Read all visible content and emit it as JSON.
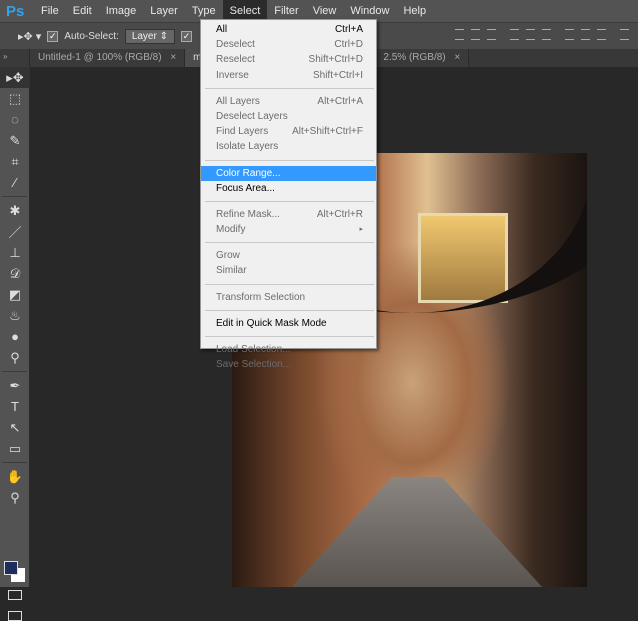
{
  "app": {
    "logo": "Ps"
  },
  "menubar": [
    "File",
    "Edit",
    "Image",
    "Layer",
    "Type",
    "Select",
    "Filter",
    "View",
    "Window",
    "Help"
  ],
  "options": {
    "auto_select_label": "Auto-Select:",
    "auto_select_checked": true,
    "target": "Layer",
    "check2": "✓"
  },
  "tabs": [
    {
      "label": "Untitled-1 @ 100% (RGB/8)",
      "close": "×"
    },
    {
      "label": "mar",
      "close": ""
    },
    {
      "label": "2.5% (RGB/8)",
      "close": "×"
    }
  ],
  "select_menu": [
    [
      {
        "label": "All",
        "shortcut": "Ctrl+A",
        "enabled": true
      },
      {
        "label": "Deselect",
        "shortcut": "Ctrl+D"
      },
      {
        "label": "Reselect",
        "shortcut": "Shift+Ctrl+D"
      },
      {
        "label": "Inverse",
        "shortcut": "Shift+Ctrl+I"
      }
    ],
    [
      {
        "label": "All Layers",
        "shortcut": "Alt+Ctrl+A"
      },
      {
        "label": "Deselect Layers",
        "shortcut": ""
      },
      {
        "label": "Find Layers",
        "shortcut": "Alt+Shift+Ctrl+F"
      },
      {
        "label": "Isolate Layers",
        "shortcut": ""
      }
    ],
    [
      {
        "label": "Color Range...",
        "shortcut": "",
        "highlighted": true
      },
      {
        "label": "Focus Area...",
        "shortcut": "",
        "enabled": true
      }
    ],
    [
      {
        "label": "Refine Mask...",
        "shortcut": "Alt+Ctrl+R"
      },
      {
        "label": "Modify",
        "shortcut": "▸"
      }
    ],
    [
      {
        "label": "Grow",
        "shortcut": ""
      },
      {
        "label": "Similar",
        "shortcut": ""
      }
    ],
    [
      {
        "label": "Transform Selection",
        "shortcut": ""
      }
    ],
    [
      {
        "label": "Edit in Quick Mask Mode",
        "shortcut": "",
        "enabled": true
      }
    ],
    [
      {
        "label": "Load Selection...",
        "shortcut": ""
      },
      {
        "label": "Save Selection...",
        "shortcut": ""
      }
    ]
  ],
  "tools": [
    [
      "move",
      "▸✥"
    ],
    [
      "marquee",
      "⬚"
    ],
    [
      "lasso",
      "◌"
    ],
    [
      "quick-select",
      "✎"
    ],
    [
      "crop",
      "⌗"
    ],
    [
      "eyedropper",
      "⁄"
    ],
    null,
    [
      "healing",
      "✱"
    ],
    [
      "brush",
      "／"
    ],
    [
      "stamp",
      "⊥"
    ],
    [
      "history-brush",
      "𝒟"
    ],
    [
      "eraser",
      "◩"
    ],
    [
      "paint-bucket",
      "♨"
    ],
    [
      "blur",
      "●"
    ],
    [
      "dodge",
      "⚲"
    ],
    null,
    [
      "pen",
      "✒"
    ],
    [
      "type",
      "T"
    ],
    [
      "path-select",
      "↖"
    ],
    [
      "rectangle",
      "▭"
    ],
    null,
    [
      "hand",
      "✋"
    ],
    [
      "zoom",
      "⚲"
    ]
  ],
  "colors": {
    "foreground": "#1c2d5e",
    "background": "#ffffff",
    "highlight": "#3399ff"
  }
}
